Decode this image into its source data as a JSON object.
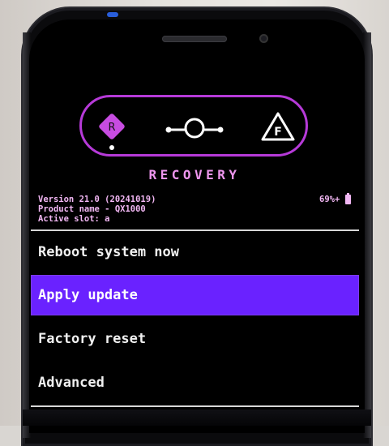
{
  "header": {
    "title": "RECOVERY",
    "icons": [
      "recovery-diamond-icon",
      "lineage-logo-icon",
      "fastboot-triangle-icon"
    ],
    "r_glyph": "R",
    "f_glyph": "F"
  },
  "info": {
    "version": "Version 21.0 (20241019)",
    "product": "Product name - QX1000",
    "slot": "Active slot: a"
  },
  "battery": {
    "percent": "69%+"
  },
  "menu": {
    "items": [
      {
        "label": "Reboot system now",
        "selected": false
      },
      {
        "label": "Apply update",
        "selected": true
      },
      {
        "label": "Factory reset",
        "selected": false
      },
      {
        "label": "Advanced",
        "selected": false
      }
    ]
  },
  "colors": {
    "accent": "#b63ad8",
    "title": "#ee96ee",
    "selection": "#6a22ff"
  }
}
